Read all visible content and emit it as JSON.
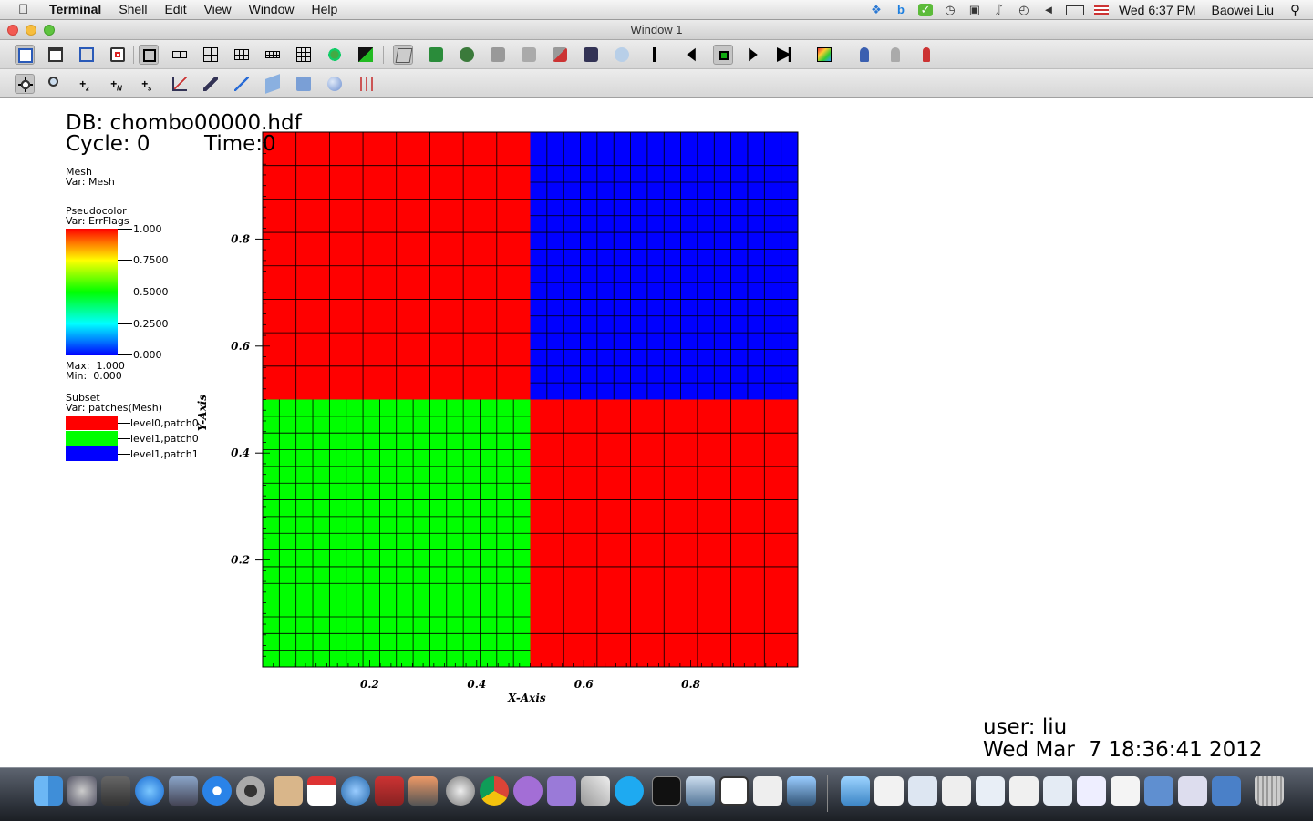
{
  "menubar": {
    "app": "Terminal",
    "menus": [
      "Shell",
      "Edit",
      "View",
      "Window",
      "Help"
    ],
    "clock": "Wed 6:37 PM",
    "user": "Baowei Liu"
  },
  "window": {
    "title": "Window 1"
  },
  "annotations": {
    "db": "DB: chombo00000.hdf",
    "cycle": "Cycle: 0",
    "time": "Time:0",
    "user": "user: liu",
    "date": "Wed Mar  7 18:36:41 2012"
  },
  "legend": {
    "mesh_title": "Mesh",
    "mesh_var": "Var: Mesh",
    "pc_title": "Pseudocolor",
    "pc_var": "Var: ErrFlags",
    "pc_ticks": [
      "1.000",
      "0.7500",
      "0.5000",
      "0.2500",
      "0.000"
    ],
    "pc_max": "Max:  1.000",
    "pc_min": "Min:  0.000",
    "subset_title": "Subset",
    "subset_var": "Var: patches(Mesh)",
    "subsets": [
      {
        "label": "level0,patch0",
        "color": "#ff0000"
      },
      {
        "label": "level1,patch0",
        "color": "#00ff00"
      },
      {
        "label": "level1,patch1",
        "color": "#0000ff"
      }
    ]
  },
  "chart_data": {
    "type": "heatmap",
    "xlabel": "X-Axis",
    "ylabel": "Y-Axis",
    "xlim": [
      0,
      1
    ],
    "ylim": [
      0,
      1
    ],
    "x_ticks": [
      "0.2",
      "0.4",
      "0.6",
      "0.8"
    ],
    "y_ticks": [
      "0.2",
      "0.4",
      "0.6",
      "0.8"
    ],
    "x_tick_values": [
      0.2,
      0.4,
      0.6,
      0.8
    ],
    "y_tick_values": [
      0.2,
      0.4,
      0.6,
      0.8
    ],
    "patches": [
      {
        "name": "level0,patch0",
        "x": [
          0,
          0.5
        ],
        "y": [
          0.5,
          1
        ],
        "cells": 8,
        "color": "#ff0000"
      },
      {
        "name": "level0,patch0",
        "x": [
          0.5,
          1
        ],
        "y": [
          0,
          0.5
        ],
        "cells": 8,
        "color": "#ff0000"
      },
      {
        "name": "level1,patch0",
        "x": [
          0,
          0.5
        ],
        "y": [
          0,
          0.5
        ],
        "cells": 16,
        "color": "#00ff00"
      },
      {
        "name": "level1,patch1",
        "x": [
          0.5,
          1
        ],
        "y": [
          0.5,
          1
        ],
        "cells": 16,
        "color": "#0000ff"
      }
    ]
  },
  "colors": {
    "accent": "#ff0000"
  }
}
